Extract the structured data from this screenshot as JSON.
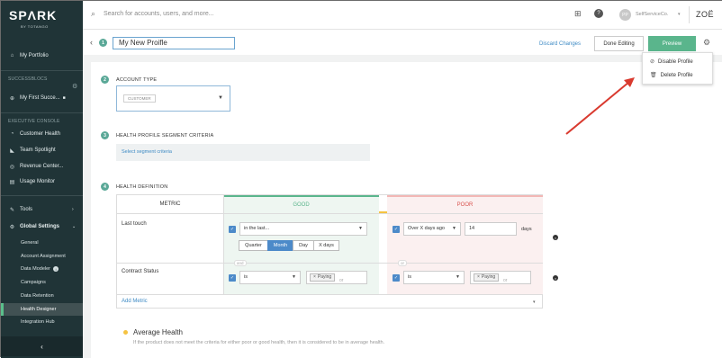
{
  "brand": {
    "logo": "SPΛRK",
    "by": "BY TOTANGO"
  },
  "sidebar": {
    "my_portfolio": "My Portfolio",
    "successblocs_label": "SUCCESSBLOCS",
    "my_first_success": "My First Succe...",
    "exec_console_label": "EXECUTIVE CONSOLE",
    "exec_items": [
      "Customer Health",
      "Team Spotlight",
      "Revenue Center...",
      "Usage Monitor"
    ],
    "tools": "Tools",
    "global_settings": "Global Settings",
    "settings_items": [
      "General",
      "Account Assignment",
      "Data Modeler",
      "Campaigns",
      "Data Retention",
      "Health Designer",
      "Integration Hub"
    ]
  },
  "topbar": {
    "search_placeholder": "Search for accounts, users, and more...",
    "avatar_initials": "PP",
    "tenant": "SelfServiceCo.",
    "user_logo": "ZOË"
  },
  "header": {
    "step1": "1",
    "profile_name": "My New Proifle",
    "discard": "Discard Changes",
    "done": "Done Editing",
    "preview": "Preview"
  },
  "menu": {
    "disable": "Disable Profile",
    "delete": "Delete Profile"
  },
  "sections": {
    "account_type": {
      "step": "2",
      "title": "ACCOUNT TYPE",
      "value": "CUSTOMER"
    },
    "segment": {
      "step": "3",
      "title": "HEALTH PROFILE SEGMENT CRITERIA",
      "link": "Select segment criteria"
    },
    "health": {
      "step": "4",
      "title": "HEALTH DEFINITION"
    }
  },
  "table": {
    "headers": {
      "metric": "METRIC",
      "good": "GOOD",
      "poor": "POOR"
    },
    "rows": [
      {
        "metric": "Last touch",
        "good_op": "in the last...",
        "poor_op": "Over X days ago",
        "poor_value": "14",
        "poor_unit": "days",
        "period_buttons": [
          "Quarter",
          "Month",
          "Day",
          "X days"
        ],
        "active_period": "Month"
      },
      {
        "metric": "Contract Status",
        "good_op": "is",
        "good_chip": "Paying",
        "poor_op": "is",
        "poor_chip": "Paying",
        "or": "or"
      }
    ],
    "and_label": "and",
    "add_metric": "Add Metric"
  },
  "average": {
    "title": "Average Health",
    "desc": "If the product does not meet the criteria for either poor or good health, then it is considered to be in average health."
  },
  "colors": {
    "accent": "#5ab58c",
    "sidebar": "#203437",
    "link": "#3d8ac4",
    "arrow": "#d93a2f"
  }
}
